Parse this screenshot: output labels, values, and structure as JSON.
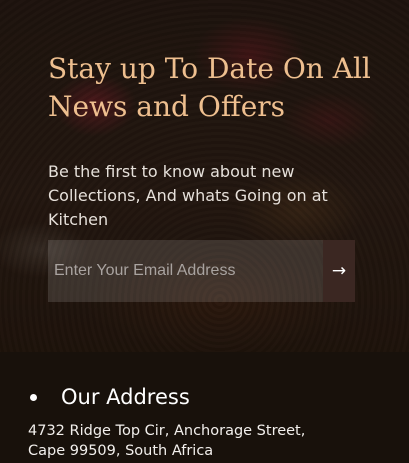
{
  "newsletter": {
    "headline": "Stay up To Date On All News and Offers",
    "subtext": "Be the first to know about new Collections, And whats Going on at Kitchen",
    "email_placeholder": "Enter Your Email Address",
    "submit_label": "→"
  },
  "footer": {
    "address_title": "Our Address",
    "address_text": "4732 Ridge Top Cir, Anchorage Street, Cape 99509, South Africa"
  },
  "colors": {
    "headline": "#eebf8f",
    "footer_background": "#18110b",
    "submit_button": "#3b2722"
  }
}
